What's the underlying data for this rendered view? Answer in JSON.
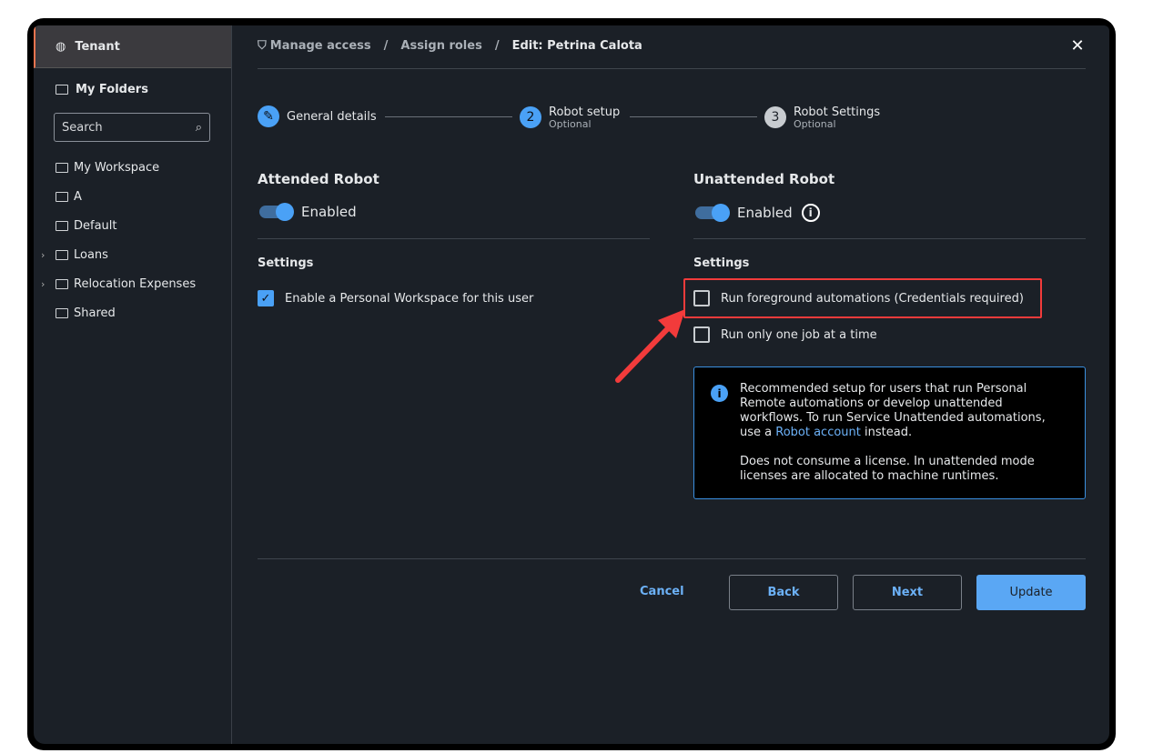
{
  "sidebar": {
    "tenant": "Tenant",
    "my_folders": "My Folders",
    "search_placeholder": "Search",
    "items": [
      {
        "label": "My Workspace"
      },
      {
        "label": "A"
      },
      {
        "label": "Default"
      },
      {
        "label": "Loans",
        "expandable": true
      },
      {
        "label": "Relocation Expenses",
        "expandable": true
      },
      {
        "label": "Shared"
      }
    ]
  },
  "breadcrumb": {
    "items": [
      "Manage access",
      "Assign roles",
      "Edit: Petrina Calota"
    ],
    "separator": "/"
  },
  "steps": [
    {
      "num": "",
      "label": "General details",
      "icon": "pencil-icon"
    },
    {
      "num": "2",
      "label": "Robot setup",
      "sub": "Optional"
    },
    {
      "num": "3",
      "label": "Robot Settings",
      "sub": "Optional"
    }
  ],
  "attended": {
    "title": "Attended Robot",
    "toggle_label": "Enabled",
    "enabled": true,
    "settings_title": "Settings",
    "options": [
      {
        "label": "Enable a Personal Workspace for this user",
        "checked": true
      }
    ]
  },
  "unattended": {
    "title": "Unattended Robot",
    "toggle_label": "Enabled",
    "enabled": true,
    "settings_title": "Settings",
    "options": [
      {
        "label": "Run foreground automations (Credentials required)",
        "checked": false
      },
      {
        "label": "Run only one job at a time",
        "checked": false
      }
    ],
    "info": {
      "text1": "Recommended setup for users that run Personal Remote automations or develop unattended workflows. To run Service Unattended automations, use a ",
      "link": "Robot account",
      "text2": " instead.",
      "text3": "Does not consume a license. In unattended mode licenses are allocated to machine runtimes."
    }
  },
  "footer": {
    "cancel": "Cancel",
    "back": "Back",
    "next": "Next",
    "update": "Update"
  },
  "colors": {
    "accent": "#4aa1f6",
    "highlight": "#f23b3b"
  }
}
